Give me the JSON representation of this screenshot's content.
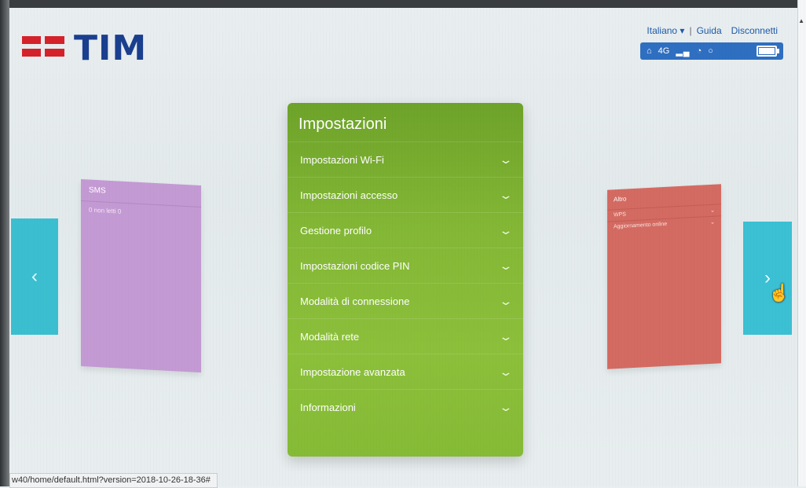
{
  "header": {
    "brand": "TIM",
    "links": {
      "language": "Italiano ▾",
      "help": "Guida",
      "logout": "Disconnetti"
    },
    "status": {
      "network": "4G",
      "icons": [
        "home-icon",
        "signal-icon",
        "wifi-icon",
        "battery-icon"
      ]
    }
  },
  "carousel": {
    "left_card": {
      "title": "SMS",
      "line": "0 non letti 0"
    },
    "right_card": {
      "title": "Altro",
      "items": [
        "WPS",
        "Aggiornamento online"
      ]
    },
    "prev_label": "‹",
    "next_label": "›"
  },
  "panel": {
    "title": "Impostazioni",
    "items": [
      "Impostazioni Wi-Fi",
      "Impostazioni accesso",
      "Gestione profilo",
      "Impostazioni codice PIN",
      "Modalità di connessione",
      "Modalità rete",
      "Impostazione avanzata",
      "Informazioni"
    ]
  },
  "statusbar": {
    "url": "w40/home/default.html?version=2018-10-26-18-36#"
  },
  "colors": {
    "panel": "#86bb36",
    "sms": "#c49ad4",
    "altro": "#d46b62",
    "nav": "#3bbfd0",
    "brand_red": "#d5222a",
    "brand_blue": "#1a3f8f"
  }
}
